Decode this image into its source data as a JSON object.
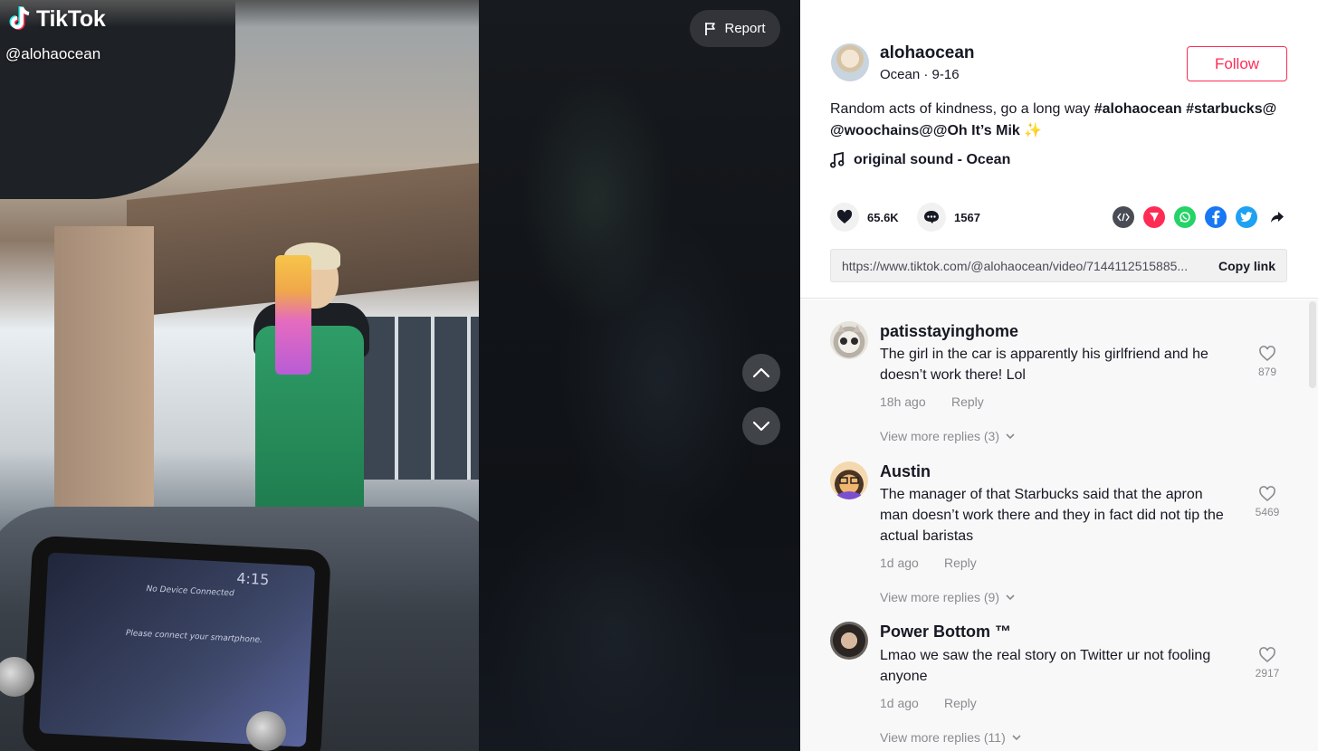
{
  "brand": {
    "name": "TikTok"
  },
  "video": {
    "watermark_handle": "@alohaocean",
    "report_label": "Report",
    "car_screen": {
      "clock": "4:15",
      "line1": "No Device Connected",
      "line2": "Please connect your smartphone."
    }
  },
  "post": {
    "author": "alohaocean",
    "meta": "Ocean · 9-16",
    "follow_label": "Follow",
    "description_text": "Random acts of kindness, go a long way ",
    "description_tags": "#alohaocean #starbucks@",
    "description_mentions": "@woochains@@Oh It’s Mik",
    "description_emoji": "✨",
    "sound": "original sound - Ocean",
    "likes": "65.6K",
    "comments_count": "1567",
    "link_url": "https://www.tiktok.com/@alohaocean/video/7144112515885...",
    "copy_link_label": "Copy link",
    "colors": {
      "accent": "#fe2c55",
      "text": "#161823",
      "muted": "#8a8b91"
    }
  },
  "share_icons": [
    "embed-icon",
    "send-icon",
    "whatsapp-icon",
    "facebook-icon",
    "twitter-icon",
    "share-arrow-icon"
  ],
  "comments": [
    {
      "user": "patisstayinghome",
      "text": "The girl in the car is apparently his girlfriend and he doesn’t work there! Lol",
      "time": "18h ago",
      "reply_label": "Reply",
      "likes": "879",
      "more_replies": "View more replies (3)"
    },
    {
      "user": "Austin",
      "text": "The manager of that Starbucks said that the apron man doesn’t work there and they in fact did not tip the actual baristas",
      "time": "1d ago",
      "reply_label": "Reply",
      "likes": "5469",
      "more_replies": "View more replies (9)"
    },
    {
      "user": "Power Bottom ™",
      "text": "Lmao we saw the real story on Twitter ur not fooling anyone",
      "time": "1d ago",
      "reply_label": "Reply",
      "likes": "2917",
      "more_replies": "View more replies (11)"
    }
  ]
}
